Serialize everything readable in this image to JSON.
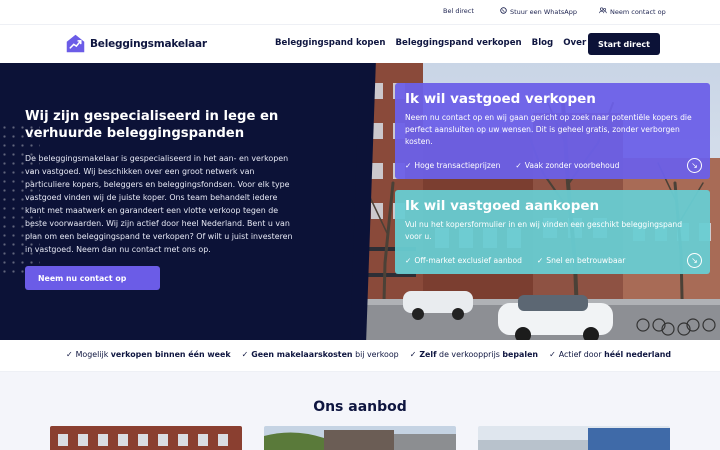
{
  "topbar": {
    "call": "Bel direct",
    "whatsapp": "Stuur een WhatsApp",
    "contact": "Neem contact op"
  },
  "nav": {
    "logo": "Beleggingsmakelaar",
    "links": [
      "Beleggingspand kopen",
      "Beleggingspand verkopen",
      "Blog",
      "Over ons"
    ],
    "cta": "Start direct"
  },
  "hero": {
    "title": "Wij zijn gespecialiseerd in lege en verhuurde beleggingspanden",
    "description": "De beleggingsmakelaar is gespecialiseerd in het aan- en verkopen van vastgoed. Wij beschikken over een groot netwerk van particuliere kopers, beleggers en beleggingsfondsen. Voor elk type vastgoed vinden wij de juiste koper. Ons team behandelt iedere klant met maatwerk en garandeert een vlotte verkoop tegen de beste voorwaarden. Wij zijn actief door heel Nederland. Bent u van plan om een beleggingspand te verkopen? Of wilt u juist investeren in vastgoed. Neem dan nu contact met ons op.",
    "button": "Neem nu contact op"
  },
  "cards": {
    "sell": {
      "title": "Ik wil vastgoed verkopen",
      "text": "Neem nu contact op en wij gaan gericht op zoek naar potentiële kopers die perfect aansluiten op uw wensen. Dit is geheel gratis, zonder verborgen kosten.",
      "features": [
        "Hoge transactieprijzen",
        "Vaak zonder voorbehoud"
      ],
      "color": "#6c60e8"
    },
    "buy": {
      "title": "Ik wil vastgoed aankopen",
      "text": "Vul nu het kopersformulier in en wij vinden een geschikt beleggingspand voor u.",
      "features": [
        "Off-market exclusief aanbod",
        "Snel en betrouwbaar"
      ],
      "color": "#68ccd2"
    }
  },
  "usp": [
    {
      "pre": "Mogelijk ",
      "bold": "verkopen binnen één week",
      "post": ""
    },
    {
      "pre": "",
      "bold": "Geen makelaarskosten",
      "post": " bij verkoop"
    },
    {
      "pre": "",
      "bold": "Zelf",
      "post": " de verkoopprijs bepalen"
    },
    {
      "pre": "Actief door ",
      "bold": "héél nederland",
      "post": ""
    }
  ],
  "usp_markup": {
    "u2_bold2": "bepalen"
  },
  "offer": {
    "title": "Ons aanbod"
  },
  "colors": {
    "navy": "#0c1237",
    "accent": "#6b5ce7",
    "teal": "#68ccd2"
  }
}
